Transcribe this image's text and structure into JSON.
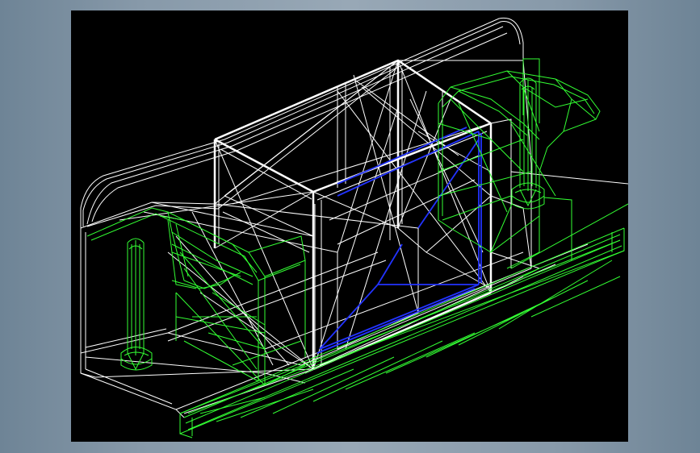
{
  "viewport": {
    "background": "#000000",
    "line_colors": {
      "body": "#ffffff",
      "clamp": "#33ff33",
      "hidden": "#1a1aff"
    }
  },
  "model": {
    "parts": [
      "housing",
      "window-frame",
      "left-clamp",
      "right-clamp",
      "base-rail",
      "left-bolt",
      "right-bolt"
    ]
  }
}
